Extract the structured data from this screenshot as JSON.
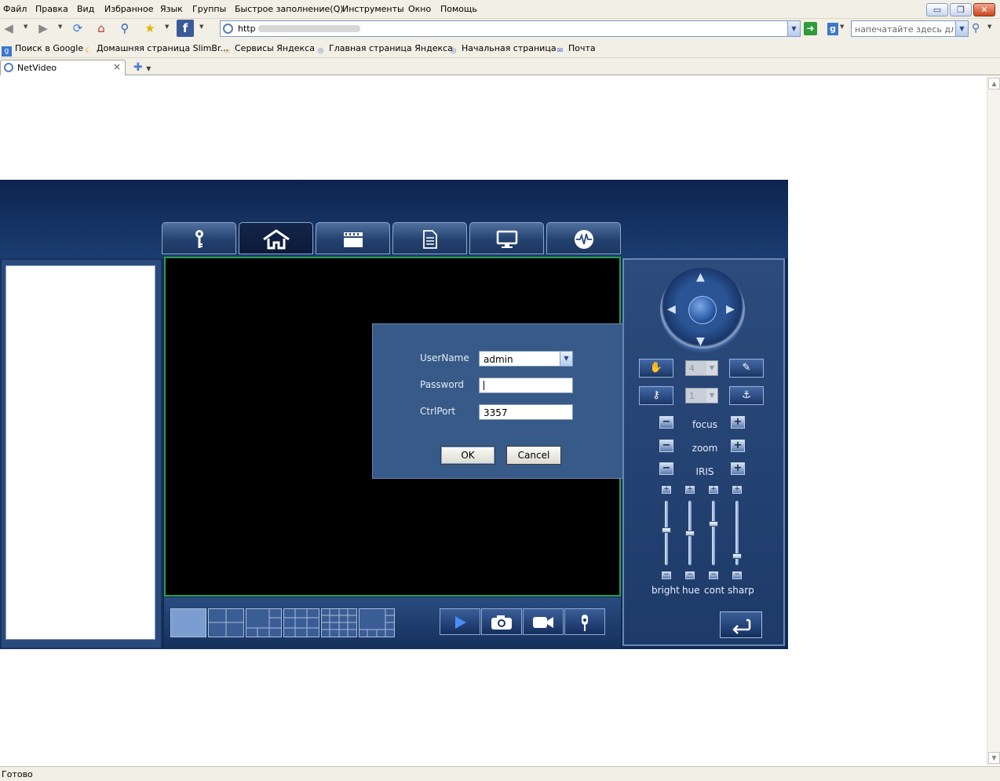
{
  "browser": {
    "menu": [
      "Файл",
      "Правка",
      "Вид",
      "Избранное",
      "Язык",
      "Группы",
      "Быстрое заполнение(Q)",
      "Инструменты",
      "Окно",
      "Помощь"
    ],
    "window_controls": {
      "minimize": "▭",
      "restore": "❐",
      "close": "✕"
    },
    "address": {
      "prefix": "http"
    },
    "search_placeholder": "напечатайте здесь для п",
    "favorites": [
      "Поиск в Google",
      "Домашняя страница SlimBr...",
      "Сервисы Яндекса",
      "Главная страница Яндекса",
      "Начальная страница",
      "Почта"
    ],
    "tab_title": "NetVideo",
    "status": "Готово"
  },
  "app": {
    "nav_tabs": [
      {
        "icon": "key-icon"
      },
      {
        "icon": "home-icon",
        "active": true
      },
      {
        "icon": "clapperboard-icon"
      },
      {
        "icon": "document-icon"
      },
      {
        "icon": "monitor-icon"
      },
      {
        "icon": "waveform-icon"
      }
    ],
    "layout_buttons": [
      "1x1",
      "2x2",
      "1+5",
      "3x3",
      "4x4",
      "1+7"
    ],
    "controls": {
      "focus": "focus",
      "zoom": "zoom",
      "iris": "IRIS",
      "speed_value": "4",
      "preset_value": "1"
    },
    "sliders": [
      {
        "label": "bright",
        "level": 0.55
      },
      {
        "label": "hue",
        "level": 0.5
      },
      {
        "label": "cont",
        "level": 0.65
      },
      {
        "label": "sharp",
        "level": 0.15
      }
    ],
    "colors": {
      "video_border": "#2aa04a",
      "panel": "#1d3a68",
      "dialog": "#385a88"
    }
  },
  "login_dialog": {
    "username_label": "UserName",
    "username_value": "admin",
    "password_label": "Password",
    "password_value": "",
    "ctrlport_label": "CtrlPort",
    "ctrlport_value": "3357",
    "ok_label": "OK",
    "cancel_label": "Cancel"
  }
}
